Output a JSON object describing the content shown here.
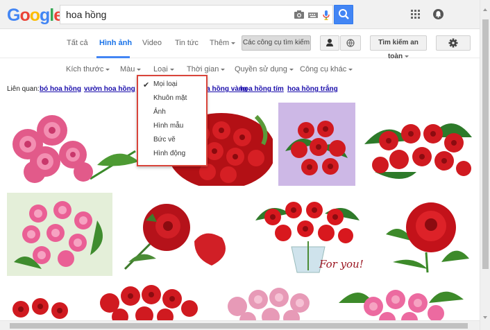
{
  "search": {
    "query": "hoa hồng"
  },
  "brand": {
    "logo_letters": [
      "G",
      "o",
      "o",
      "g",
      "l",
      "e"
    ],
    "logo_colors": [
      "#4285f4",
      "#ea4335",
      "#fbbc05",
      "#4285f4",
      "#34a853",
      "#ea4335"
    ]
  },
  "tabs": {
    "items": [
      "Tất cả",
      "Hình ảnh",
      "Video",
      "Tin tức",
      "Thêm"
    ],
    "active": "Hình ảnh",
    "tools_label": "Các công cụ tìm kiếm",
    "safe_search_label": "Tìm kiếm an toàn"
  },
  "filters": {
    "items": [
      "Kích thước",
      "Màu",
      "Loại",
      "Thời gian",
      "Quyền sử dụng",
      "Công cụ khác"
    ]
  },
  "related": {
    "label": "Liên quan:",
    "links": [
      "bó hoa hồng",
      "vườn hoa hồng",
      "hoa hồng vàng",
      "hoa hồng tím",
      "hoa hồng trắng"
    ]
  },
  "type_dropdown": {
    "selected": "Mọi loại",
    "options": [
      "Mọi loại",
      "Khuôn mặt",
      "Ảnh",
      "Hình mẫu",
      "Bức vẽ",
      "Hình động"
    ]
  },
  "image_caption": "For you!",
  "icons": [
    "camera-icon",
    "keyboard-icon",
    "microphone-icon",
    "search-icon",
    "apps-grid-icon",
    "notifications-icon",
    "person-icon",
    "globe-icon",
    "gear-icon",
    "check-icon"
  ],
  "colors": {
    "accent": "#4285f4",
    "highlight_border": "#d9443a",
    "link": "#1a0dab"
  }
}
